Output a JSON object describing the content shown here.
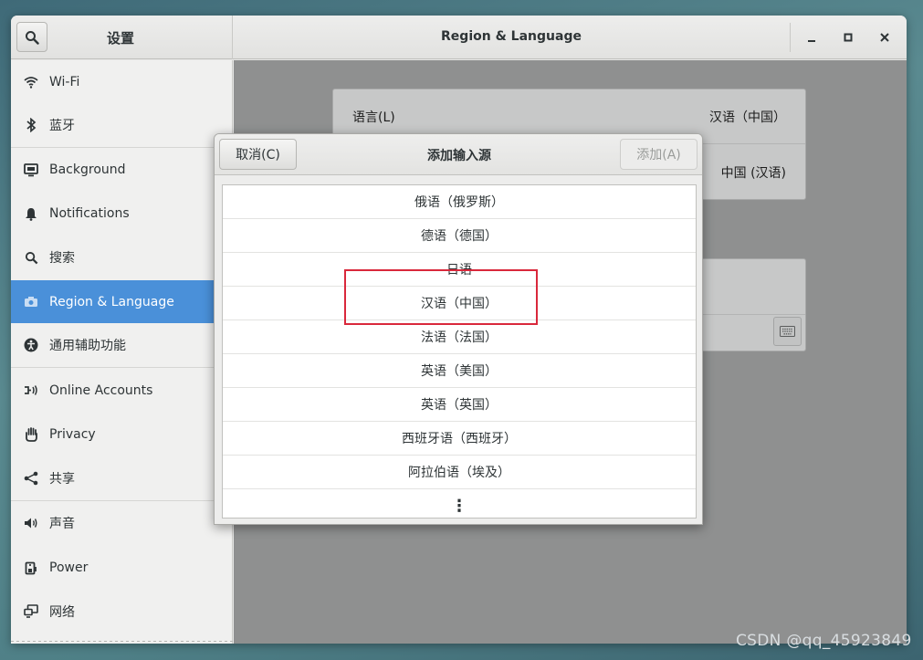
{
  "headerbar": {
    "left_title": "设置",
    "title": "Region & Language",
    "minimize_label": "_",
    "maximize_label": "□",
    "close_label": "×"
  },
  "sidebar": {
    "items": [
      {
        "label": "Wi-Fi",
        "icon": "wifi-icon"
      },
      {
        "label": "蓝牙",
        "icon": "bluetooth-icon"
      },
      {
        "label": "Background",
        "icon": "background-icon"
      },
      {
        "label": "Notifications",
        "icon": "bell-icon"
      },
      {
        "label": "搜索",
        "icon": "search-icon"
      },
      {
        "label": "Region & Language",
        "icon": "camera-icon",
        "active": true
      },
      {
        "label": "通用辅助功能",
        "icon": "accessibility-icon"
      },
      {
        "label": "Online Accounts",
        "icon": "online-accounts-icon"
      },
      {
        "label": "Privacy",
        "icon": "hand-icon"
      },
      {
        "label": "共享",
        "icon": "share-icon"
      },
      {
        "label": "声音",
        "icon": "speaker-icon"
      },
      {
        "label": "Power",
        "icon": "power-icon"
      },
      {
        "label": "网络",
        "icon": "network-icon"
      }
    ]
  },
  "content": {
    "language_label": "语言(L)",
    "language_value": "汉语（中国）",
    "formats_value": "中国 (汉语)"
  },
  "dialog": {
    "cancel_label": "取消(C)",
    "title": "添加输入源",
    "add_label": "添加(A)",
    "items": [
      "俄语（俄罗斯）",
      "德语（德国）",
      "日语",
      "汉语（中国）",
      "法语（法国）",
      "英语（美国）",
      "英语（英国）",
      "西班牙语（西班牙）",
      "阿拉伯语（埃及）"
    ],
    "more_label": "⋮"
  },
  "watermark": "CSDN @qq_45923849",
  "colors": {
    "accent": "#4a90d9",
    "highlight_box": "#d9283b"
  }
}
